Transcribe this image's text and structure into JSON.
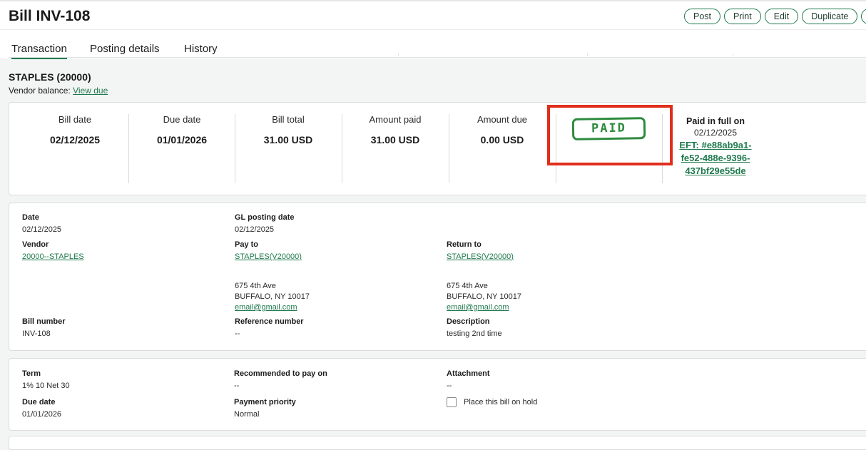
{
  "header": {
    "title": "Bill INV-108",
    "actions": [
      "Post",
      "Print",
      "Edit",
      "Duplicate"
    ]
  },
  "tabs": [
    "Transaction",
    "Posting details",
    "History"
  ],
  "vendor": {
    "name": "STAPLES (20000)",
    "balance_label": "Vendor balance:",
    "balance_link": "View due"
  },
  "summary": {
    "bill_date": {
      "label": "Bill date",
      "value": "02/12/2025"
    },
    "due_date": {
      "label": "Due date",
      "value": "01/01/2026"
    },
    "bill_total": {
      "label": "Bill total",
      "value": "31.00 USD"
    },
    "amount_paid": {
      "label": "Amount paid",
      "value": "31.00 USD"
    },
    "amount_due": {
      "label": "Amount due",
      "value": "0.00 USD"
    },
    "stamp": "PAID",
    "paid_label": "Paid in full on",
    "paid_date": "02/12/2025",
    "eft_lines": [
      "EFT: #e88ab9a1-",
      "fe52-488e-9396-",
      "437bf29e55de"
    ]
  },
  "details": {
    "date": {
      "label": "Date",
      "value": "02/12/2025"
    },
    "gl_posting_date": {
      "label": "GL posting date",
      "value": "02/12/2025"
    },
    "vendor": {
      "label": "Vendor",
      "value": "20000--STAPLES"
    },
    "pay_to": {
      "label": "Pay to",
      "value": "STAPLES(V20000)",
      "address1": "675 4th Ave",
      "address2": "BUFFALO, NY 10017",
      "email": "email@gmail.com"
    },
    "return_to": {
      "label": "Return to",
      "value": "STAPLES(V20000)",
      "address1": "675 4th Ave",
      "address2": "BUFFALO, NY 10017",
      "email": "email@gmail.com"
    },
    "bill_number": {
      "label": "Bill number",
      "value": "INV-108"
    },
    "reference_number": {
      "label": "Reference number",
      "value": "--"
    },
    "description": {
      "label": "Description",
      "value": "testing 2nd time"
    }
  },
  "terms": {
    "term": {
      "label": "Term",
      "value": "1% 10 Net 30"
    },
    "recommended": {
      "label": "Recommended to pay on",
      "value": "--"
    },
    "attachment": {
      "label": "Attachment",
      "value": "--"
    },
    "due_date": {
      "label": "Due date",
      "value": "01/01/2026"
    },
    "payment_priority": {
      "label": "Payment priority",
      "value": "Normal"
    },
    "hold_label": "Place this bill on hold"
  },
  "colors": {
    "accent": "#1f7a4d",
    "highlight": "#e02e1c",
    "stamp": "#2e8b3e"
  }
}
